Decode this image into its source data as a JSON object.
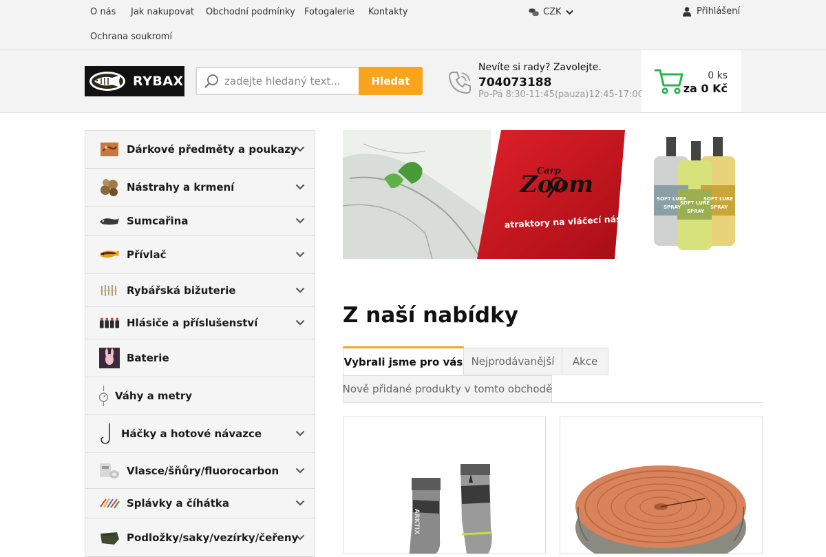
{
  "topnav": {
    "links": [
      "O nás",
      "Jak nakupovat",
      "Obchodní podmínky",
      "Fotogalerie",
      "Kontakty",
      "Ochrana soukromí"
    ],
    "currency": "CZK",
    "login": "Přihlášení"
  },
  "header": {
    "logo_text": "RYBAX",
    "search_placeholder": "zadejte hledaný text...",
    "search_button": "Hledat",
    "help_text": "Nevíte si rady? Zavolejte.",
    "phone": "704073188",
    "hours": "Po-Pá 8:30-11:45(pauza)12:45-17:00",
    "cart_count": "0 ks",
    "cart_total": "za 0 Kč"
  },
  "categories": [
    {
      "label": "Dárkové předměty a poukazy",
      "icon": "gift-voucher-icon",
      "has_children": true
    },
    {
      "label": "Nástrahy a krmení",
      "icon": "boilies-icon",
      "has_children": true
    },
    {
      "label": "Sumcařina",
      "icon": "catfish-lure-icon",
      "has_children": true
    },
    {
      "label": "Přívlač",
      "icon": "wobbler-icon",
      "has_children": true
    },
    {
      "label": "Rybářská bižuterie",
      "icon": "swivels-icon",
      "has_children": true
    },
    {
      "label": "Hlásiče a příslušenství",
      "icon": "bite-alarm-icon",
      "has_children": true
    },
    {
      "label": "Baterie",
      "icon": "battery-icon",
      "has_children": false
    },
    {
      "label": "Váhy a metry",
      "icon": "scale-icon",
      "has_children": false
    },
    {
      "label": "Háčky a hotové návazce",
      "icon": "hook-icon",
      "has_children": true
    },
    {
      "label": "Vlasce/šňůry/fluorocarbon",
      "icon": "line-spool-icon",
      "has_children": true
    },
    {
      "label": "Splávky a číhátka",
      "icon": "float-icon",
      "has_children": true
    },
    {
      "label": "Podložky/saky/vezírky/čeřeny",
      "icon": "landing-net-icon",
      "has_children": true
    }
  ],
  "banner": {
    "brand_small": "Carp",
    "brand": "Zoom",
    "tagline": "atraktory na vláčecí nástrahy",
    "spray_label": "SOFT LURE SPRAY"
  },
  "offer": {
    "title": "Z naší nabídky",
    "tabs": [
      "Vybrali jsme pro vás",
      "Nejprodávanější",
      "Akce",
      "Nově přidané produkty v tomto obchodě"
    ],
    "active_tab": 0
  },
  "products": [
    {
      "image": "socks-product-image",
      "sock_text": "ARKTIX"
    },
    {
      "image": "wood-stump-cushion-image"
    }
  ],
  "colors": {
    "accent": "#f8a51b",
    "cart_green": "#27b44a",
    "banner_red": "#c8141e"
  }
}
